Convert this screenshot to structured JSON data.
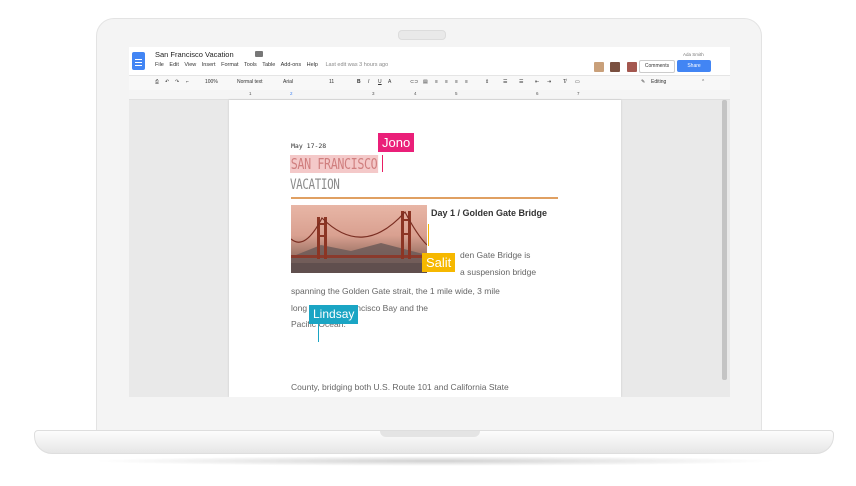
{
  "app": {
    "doc_title": "San Francisco Vacation",
    "menu": [
      "File",
      "Edit",
      "View",
      "Insert",
      "Format",
      "Tools",
      "Table",
      "Add-ons",
      "Help"
    ],
    "last_edit": "Last edit was 3 hours ago",
    "user_name": "Ada Smith",
    "comments_label": "Comments",
    "share_label": "Share"
  },
  "toolbar": {
    "zoom": "100%",
    "style": "Normal text",
    "font": "Arial",
    "size": "11",
    "mode": "Editing"
  },
  "ruler": [
    "1",
    "2",
    "3",
    "4",
    "5",
    "6",
    "7"
  ],
  "document": {
    "date": "May 17-28",
    "title_line1": "SAN FRANCISCO",
    "title_line2": "VACATION",
    "day_heading": "Day 1 / Golden Gate Bridge",
    "para_line1": "den Gate Bridge is",
    "para_line2": "a suspension bridge",
    "para_line3": "spanning the Golden Gate strait, the 1 mile wide, 3 mile",
    "para_line4": "long          een San Francisco Bay and the",
    "para_line5": "Pacific Ocean.",
    "para_line6": "County, bridging both U.S. Route 101 and California State"
  },
  "collaborators": [
    {
      "name": "Jono",
      "color": "#ea1f79"
    },
    {
      "name": "Salit",
      "color": "#f6b800"
    },
    {
      "name": "Lindsay",
      "color": "#1aa5c4"
    }
  ],
  "colors": {
    "accent_blue": "#4285f4",
    "title_highlight": "#f4c9c9",
    "rule_orange": "#e0a062"
  }
}
